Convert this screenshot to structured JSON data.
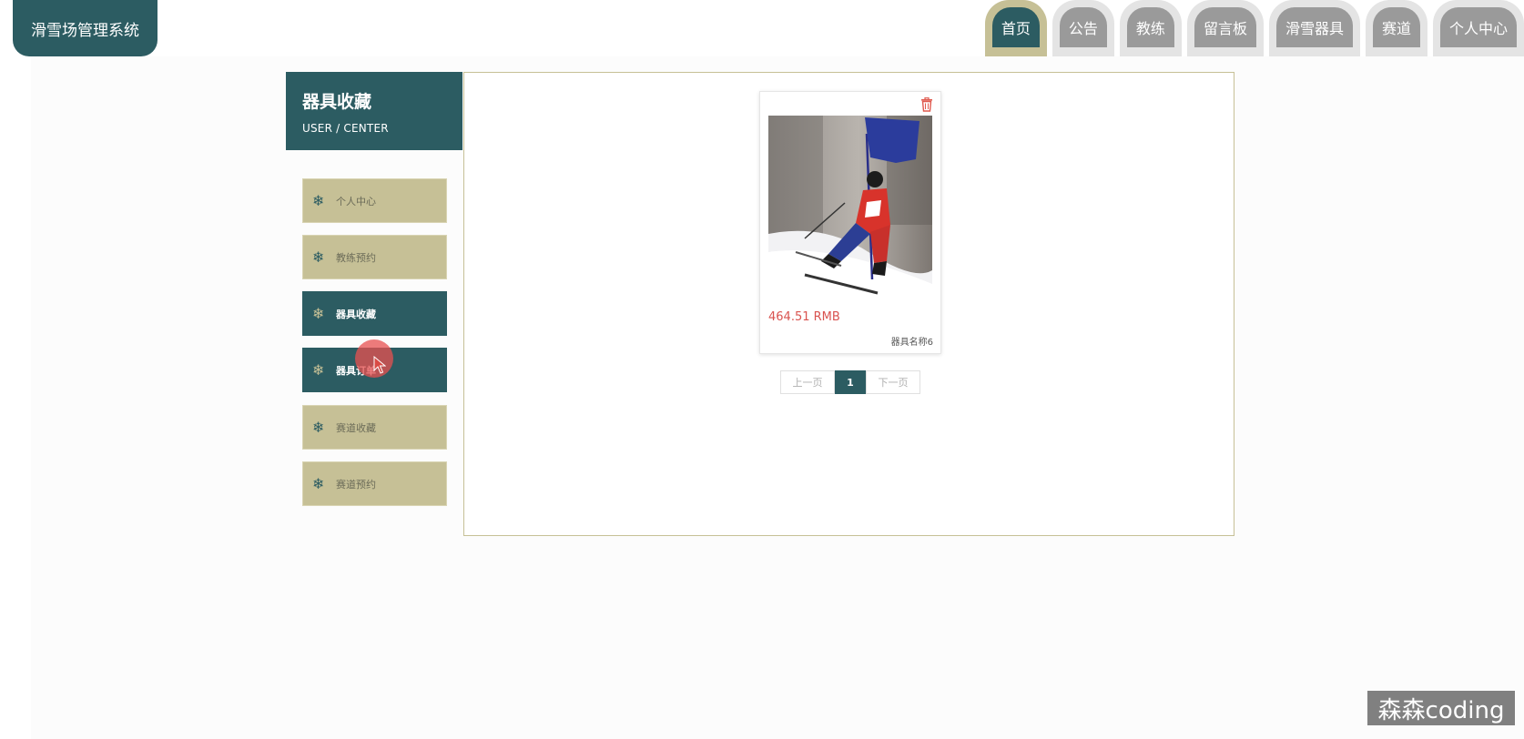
{
  "header": {
    "logo": "滑雪场管理系统",
    "nav": [
      {
        "label": "首页",
        "active": true
      },
      {
        "label": "公告",
        "active": false
      },
      {
        "label": "教练",
        "active": false
      },
      {
        "label": "留言板",
        "active": false
      },
      {
        "label": "滑雪器具",
        "active": false
      },
      {
        "label": "赛道",
        "active": false
      },
      {
        "label": "个人中心",
        "active": false
      }
    ]
  },
  "sidebar": {
    "title": "器具收藏",
    "subtitle": "USER / CENTER",
    "items": [
      {
        "label": "个人中心",
        "active": false
      },
      {
        "label": "教练预约",
        "active": false
      },
      {
        "label": "器具收藏",
        "active": true
      },
      {
        "label": "器具订单",
        "active": true
      },
      {
        "label": "赛道收藏",
        "active": false
      },
      {
        "label": "赛道预约",
        "active": false
      }
    ],
    "item_icon": "snowflake-icon"
  },
  "main": {
    "card": {
      "price": "464.51 RMB",
      "name": "器具名称6",
      "image": "skier-photo",
      "delete_icon": "trash-icon"
    },
    "pagination": {
      "prev": "上一页",
      "current": "1",
      "next": "下一页"
    }
  },
  "watermark": "森森coding",
  "colors": {
    "primary": "#2c5c62",
    "accent": "#c6c096",
    "price": "#d9534f"
  }
}
